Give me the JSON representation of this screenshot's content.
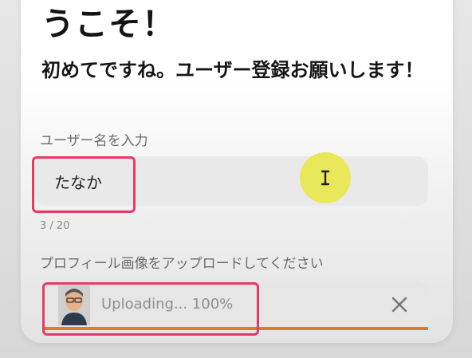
{
  "form": {
    "heading_partial": "うこそ！",
    "subheading": "初めてですね。ユーザー登録お願いします！",
    "name_label": "ユーザー名を入力",
    "name_value": "たなか",
    "name_counter": "3 / 20",
    "photo_label": "プロフィール画像をアップロードしてください",
    "upload_status": "Uploading... 100%",
    "upload_progress": 1.0
  },
  "colors": {
    "highlight": "#e8386a",
    "progress": "#e07b1f",
    "cursor": "#e9e85a"
  },
  "icons": {
    "cursor": "text-cursor-icon",
    "remove": "close-icon",
    "avatar": "user-avatar-image"
  }
}
